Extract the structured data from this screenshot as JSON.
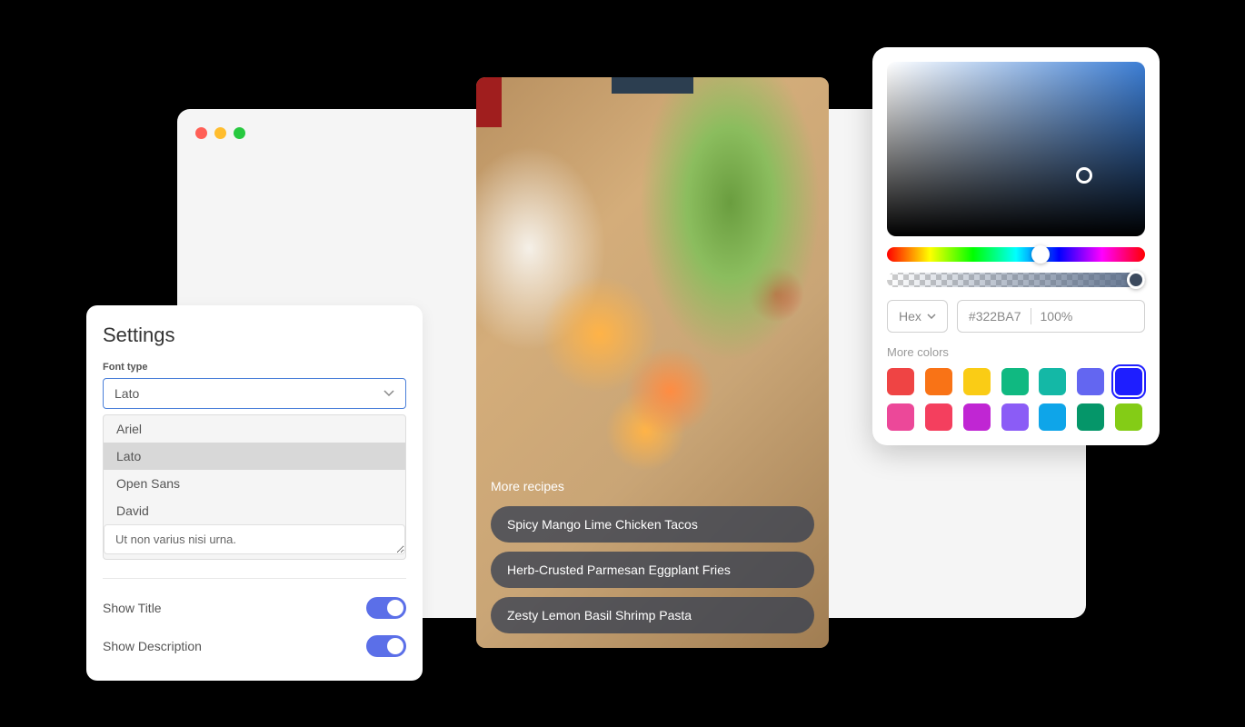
{
  "settings": {
    "title": "Settings",
    "font_label": "Font type",
    "selected_font": "Lato",
    "font_options": [
      "Ariel",
      "Lato",
      "Open Sans",
      "David"
    ],
    "textarea_value": "Ut non varius nisi urna.",
    "toggles": [
      {
        "label": "Show Title",
        "on": true
      },
      {
        "label": "Show Description",
        "on": true
      }
    ]
  },
  "recipes": {
    "heading": "More recipes",
    "items": [
      "Spicy Mango Lime Chicken Tacos",
      "Herb-Crusted Parmesan Eggplant Fries",
      "Zesty Lemon Basil Shrimp Pasta"
    ]
  },
  "color_picker": {
    "mode": "Hex",
    "hex": "#322BA7",
    "opacity": "100%",
    "more_colors_label": "More colors",
    "swatches": [
      "#ef4444",
      "#f97316",
      "#facc15",
      "#10b981",
      "#14b8a6",
      "#6366f1",
      "#1e1eff",
      "#ec4899",
      "#f43f5e",
      "#c026d3",
      "#8b5cf6",
      "#0ea5e9",
      "#059669",
      "#84cc16"
    ],
    "selected_swatch_index": 6
  }
}
